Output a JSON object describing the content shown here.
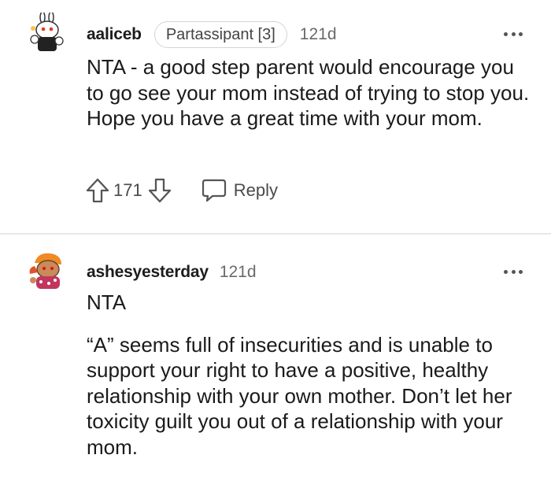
{
  "comments": [
    {
      "author": "aaliceb",
      "flair": "Partassipant [3]",
      "age": "121d",
      "paragraphs": [
        "NTA - a good step parent would encourage you to go see your mom instead of trying to stop you. Hope you have a great time with your mom."
      ],
      "score": "171",
      "reply_label": "Reply"
    },
    {
      "author": "ashesyesterday",
      "age": "121d",
      "paragraphs": [
        "NTA",
        "“A” seems full of insecurities and is unable to support your right to have a positive, healthy relationship with your own mother. Don’t let her toxicity guilt you out of a relationship with your mom."
      ]
    }
  ],
  "icons": {
    "upvote": "arrow-up-outline-icon",
    "downvote": "arrow-down-outline-icon",
    "reply": "speech-bubble-icon",
    "more": "three-dots-icon"
  }
}
